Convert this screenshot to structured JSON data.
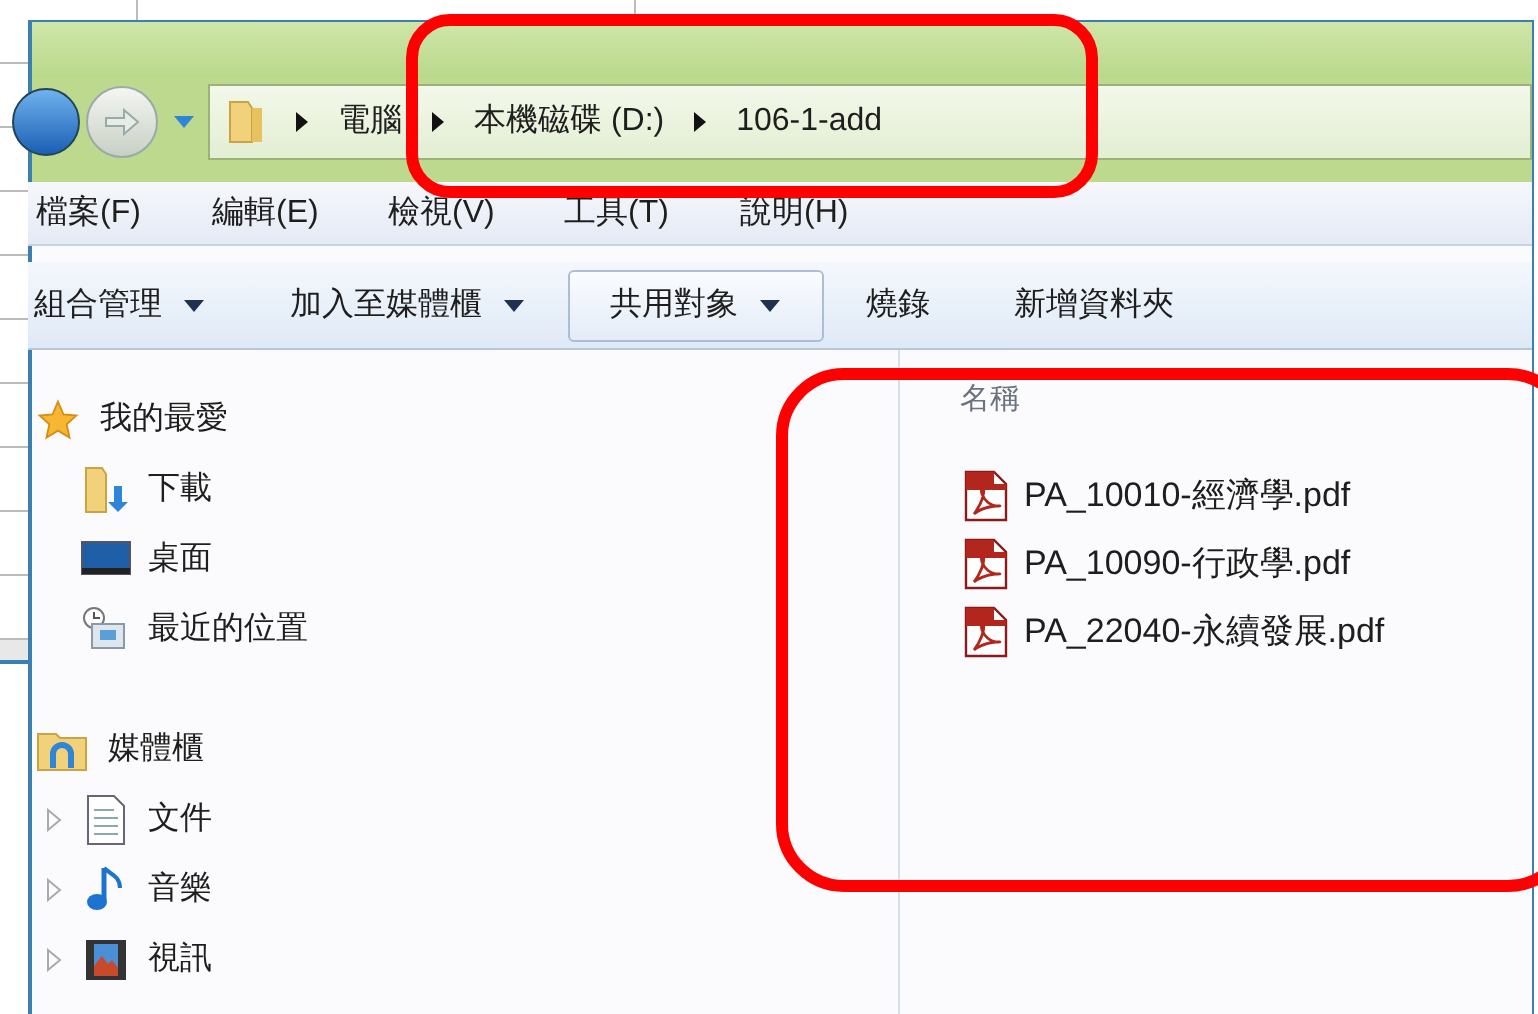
{
  "address_bar": {
    "crumbs": [
      "電腦",
      "本機磁碟 (D:)",
      "106-1-add"
    ]
  },
  "menu_bar": [
    "檔案(F)",
    "編輯(E)",
    "檢視(V)",
    "工具(T)",
    "說明(H)"
  ],
  "toolbar": [
    {
      "label": "組合管理",
      "dropdown": true,
      "selected": false
    },
    {
      "label": "加入至媒體櫃",
      "dropdown": true,
      "selected": false
    },
    {
      "label": "共用對象",
      "dropdown": true,
      "selected": true
    },
    {
      "label": "燒錄",
      "dropdown": false,
      "selected": false
    },
    {
      "label": "新增資料夾",
      "dropdown": false,
      "selected": false
    }
  ],
  "navigation": [
    {
      "label": "我的最愛",
      "kind": "star",
      "children": [
        {
          "label": "下載",
          "kind": "download",
          "expandable": false
        },
        {
          "label": "桌面",
          "kind": "desktop",
          "expandable": false
        },
        {
          "label": "最近的位置",
          "kind": "recent",
          "expandable": false
        }
      ]
    },
    {
      "label": "媒體櫃",
      "kind": "library",
      "children": [
        {
          "label": "文件",
          "kind": "document",
          "expandable": true
        },
        {
          "label": "音樂",
          "kind": "music",
          "expandable": true
        },
        {
          "label": "視訊",
          "kind": "video",
          "expandable": true
        }
      ]
    }
  ],
  "file_list": {
    "columns": [
      "名稱"
    ],
    "files": [
      {
        "name": "PA_10010-經濟學.pdf"
      },
      {
        "name": "PA_10090-行政學.pdf"
      },
      {
        "name": "PA_22040-永續發展.pdf"
      }
    ]
  }
}
